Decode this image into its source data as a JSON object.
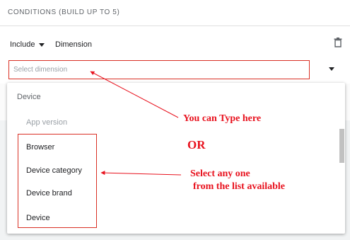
{
  "section": {
    "title": "CONDITIONS (BUILD UP TO 5)"
  },
  "condition": {
    "include_label": "Include",
    "dimension_label": "Dimension",
    "search_placeholder": "Select dimension"
  },
  "dropdown": {
    "group_header": "Device",
    "items": [
      {
        "label": "App version",
        "disabled": true
      },
      {
        "label": "Browser"
      },
      {
        "label": "Device category"
      },
      {
        "label": "Device brand"
      },
      {
        "label": "Device"
      }
    ]
  },
  "annotations": {
    "type_here": "You can Type here",
    "or": "OR",
    "select_line1": "Select any one",
    "select_line2": "from the list available"
  },
  "colors": {
    "annotation_red": "#e8121e",
    "box_red": "#d93025"
  },
  "icons": [
    "caret-down-icon",
    "trash-icon",
    "dropdown-caret-icon"
  ]
}
